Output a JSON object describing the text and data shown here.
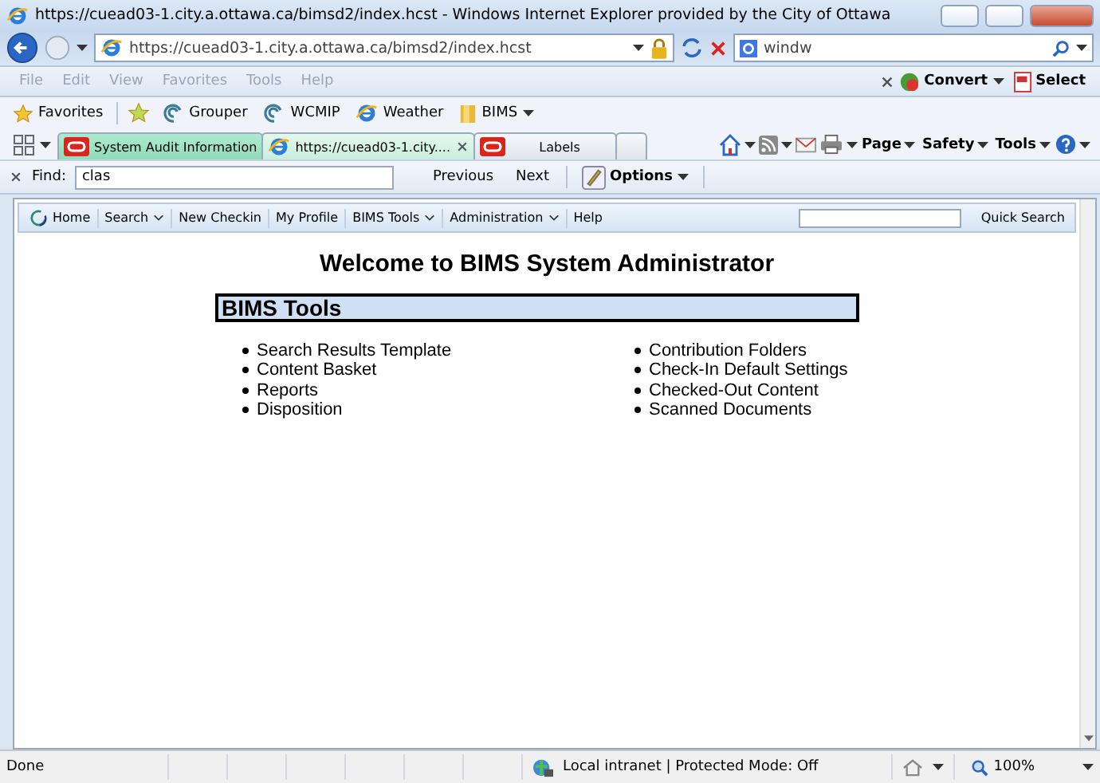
{
  "window": {
    "title": "https://cuead03-1.city.a.ottawa.ca/bimsd2/index.hcst - Windows Internet Explorer provided by the City of Ottawa"
  },
  "address_bar": {
    "url": "https://cuead03-1.city.a.ottawa.ca/bimsd2/index.hcst"
  },
  "search_box": {
    "value": "windw"
  },
  "menu_bar": {
    "items": [
      "File",
      "Edit",
      "View",
      "Favorites",
      "Tools",
      "Help"
    ],
    "tools": [
      "Convert",
      "Select"
    ]
  },
  "favorites_bar": {
    "label": "Favorites",
    "items": [
      {
        "label": "Grouper",
        "kind": "link"
      },
      {
        "label": "WCMIP",
        "kind": "link"
      },
      {
        "label": "Weather",
        "kind": "page"
      },
      {
        "label": "BIMS",
        "kind": "folder"
      }
    ]
  },
  "tabs": [
    {
      "label": "System Audit Information",
      "selected": false,
      "grouped": true,
      "kind": "app"
    },
    {
      "label": "https://cuead03-1.city....",
      "selected": true,
      "grouped": true,
      "kind": "ie"
    },
    {
      "label": "Labels",
      "selected": false,
      "grouped": false,
      "kind": "app"
    }
  ],
  "command_bar": {
    "menus": [
      "Page",
      "Safety",
      "Tools"
    ]
  },
  "find_bar": {
    "label": "Find:",
    "value": "clas",
    "buttons": [
      "Previous",
      "Next"
    ],
    "options": "Options"
  },
  "app_nav": {
    "items": [
      {
        "label": "Home",
        "dropdown": false
      },
      {
        "label": "Search",
        "dropdown": true
      },
      {
        "label": "New Checkin",
        "dropdown": false
      },
      {
        "label": "My Profile",
        "dropdown": false
      },
      {
        "label": "BIMS Tools",
        "dropdown": true
      },
      {
        "label": "Administration",
        "dropdown": true
      },
      {
        "label": "Help",
        "dropdown": false
      }
    ],
    "quick_search": "Quick Search"
  },
  "page": {
    "heading": "Welcome to BIMS System Administrator",
    "section": "BIMS Tools",
    "columns": [
      [
        "Search Results Template",
        "Content Basket",
        "Reports",
        "Disposition"
      ],
      [
        "Contribution Folders",
        "Check-In Default Settings",
        "Checked-Out Content",
        "Scanned Documents"
      ]
    ]
  },
  "status_bar": {
    "text": "Done",
    "zone": "Local intranet | Protected Mode: Off",
    "zoom": "100%"
  }
}
